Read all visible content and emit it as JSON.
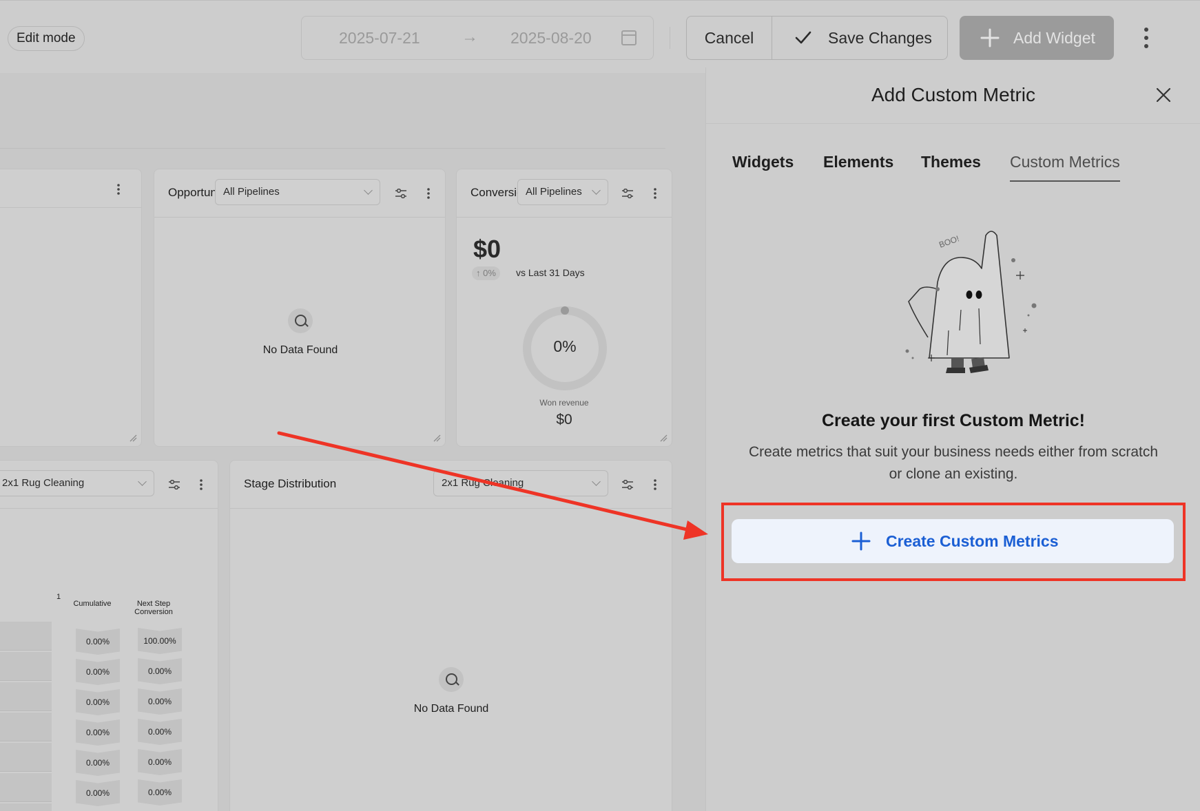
{
  "topbar": {
    "mode_label": "Edit mode",
    "date_start": "2025-07-21",
    "date_arrow": "→",
    "date_end": "2025-08-20",
    "cancel_label": "Cancel",
    "save_label": "Save Changes",
    "add_widget_label": "Add Widget"
  },
  "widgets": {
    "opportunity": {
      "title": "Opportunities",
      "pipeline": "All Pipelines",
      "empty": "No Data Found"
    },
    "conversion": {
      "title": "Conversion",
      "pipeline": "All Pipelines",
      "amount": "$0",
      "trend": "↑ 0%",
      "compare": "vs Last 31 Days",
      "rate": "0%",
      "won_label": "Won revenue",
      "won_value": "$0"
    },
    "funnel": {
      "pipeline": "2x1 Rug Cleaning",
      "col_tick": "1",
      "col_cumulative": "Cumulative",
      "col_next": "Next Step Conversion",
      "cumulative": [
        "0.00%",
        "0.00%",
        "0.00%",
        "0.00%",
        "0.00%",
        "0.00%"
      ],
      "next_step": [
        "100.00%",
        "0.00%",
        "0.00%",
        "0.00%",
        "0.00%",
        "0.00%"
      ]
    },
    "stage_distribution": {
      "title": "Stage Distribution",
      "pipeline": "2x1 Rug Cleaning",
      "empty": "No Data Found"
    }
  },
  "panel": {
    "title": "Add Custom Metric",
    "tabs": [
      {
        "label": "Widgets"
      },
      {
        "label": "Elements"
      },
      {
        "label": "Themes"
      },
      {
        "label": "Custom Metrics"
      }
    ],
    "illustration_text": "BOO!",
    "cta_title": "Create your first Custom Metric!",
    "cta_desc": "Create metrics that suit your business needs either from scratch or clone an existing.",
    "create_label": "Create Custom Metrics"
  },
  "colors": {
    "accent_blue": "#1b5fd4",
    "highlight_red": "#ee3426",
    "button_bg": "#eef3fc"
  }
}
